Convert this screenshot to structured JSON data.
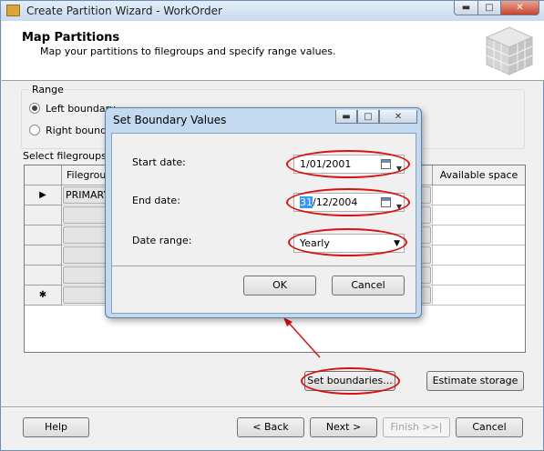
{
  "window": {
    "title": "Create Partition Wizard - WorkOrder",
    "min": "▬",
    "max": "□",
    "close": "✕"
  },
  "header": {
    "title": "Map Partitions",
    "subtitle": "Map your partitions to filegroups and specify range values."
  },
  "range": {
    "group_label": "Range",
    "left_label": "Left boundary",
    "right_label": "Right boundar",
    "selected": "left"
  },
  "grid": {
    "caption": "Select filegroups an",
    "columns": [
      "Filegroup",
      "Available space"
    ],
    "rows": [
      {
        "marker": "▶",
        "filegroup": "PRIMARY"
      },
      {
        "marker": "",
        "filegroup": ""
      },
      {
        "marker": "",
        "filegroup": ""
      },
      {
        "marker": "",
        "filegroup": ""
      },
      {
        "marker": "",
        "filegroup": ""
      },
      {
        "marker": "✱",
        "filegroup": ""
      }
    ]
  },
  "actions": {
    "set_boundaries": "Set boundaries...",
    "estimate_storage": "Estimate storage"
  },
  "footer": {
    "help": "Help",
    "back": "< Back",
    "next": "Next >",
    "finish": "Finish >>|",
    "cancel": "Cancel"
  },
  "dialog": {
    "title": "Set Boundary Values",
    "start_label": "Start date:",
    "start_value": "1/01/2001",
    "end_label": "End date:",
    "end_day": "31",
    "end_rest": "/12/2004",
    "range_label": "Date range:",
    "range_value": "Yearly",
    "ok": "OK",
    "cancel": "Cancel"
  },
  "colors": {
    "annotation": "#d81212",
    "selection": "#3399ff"
  }
}
